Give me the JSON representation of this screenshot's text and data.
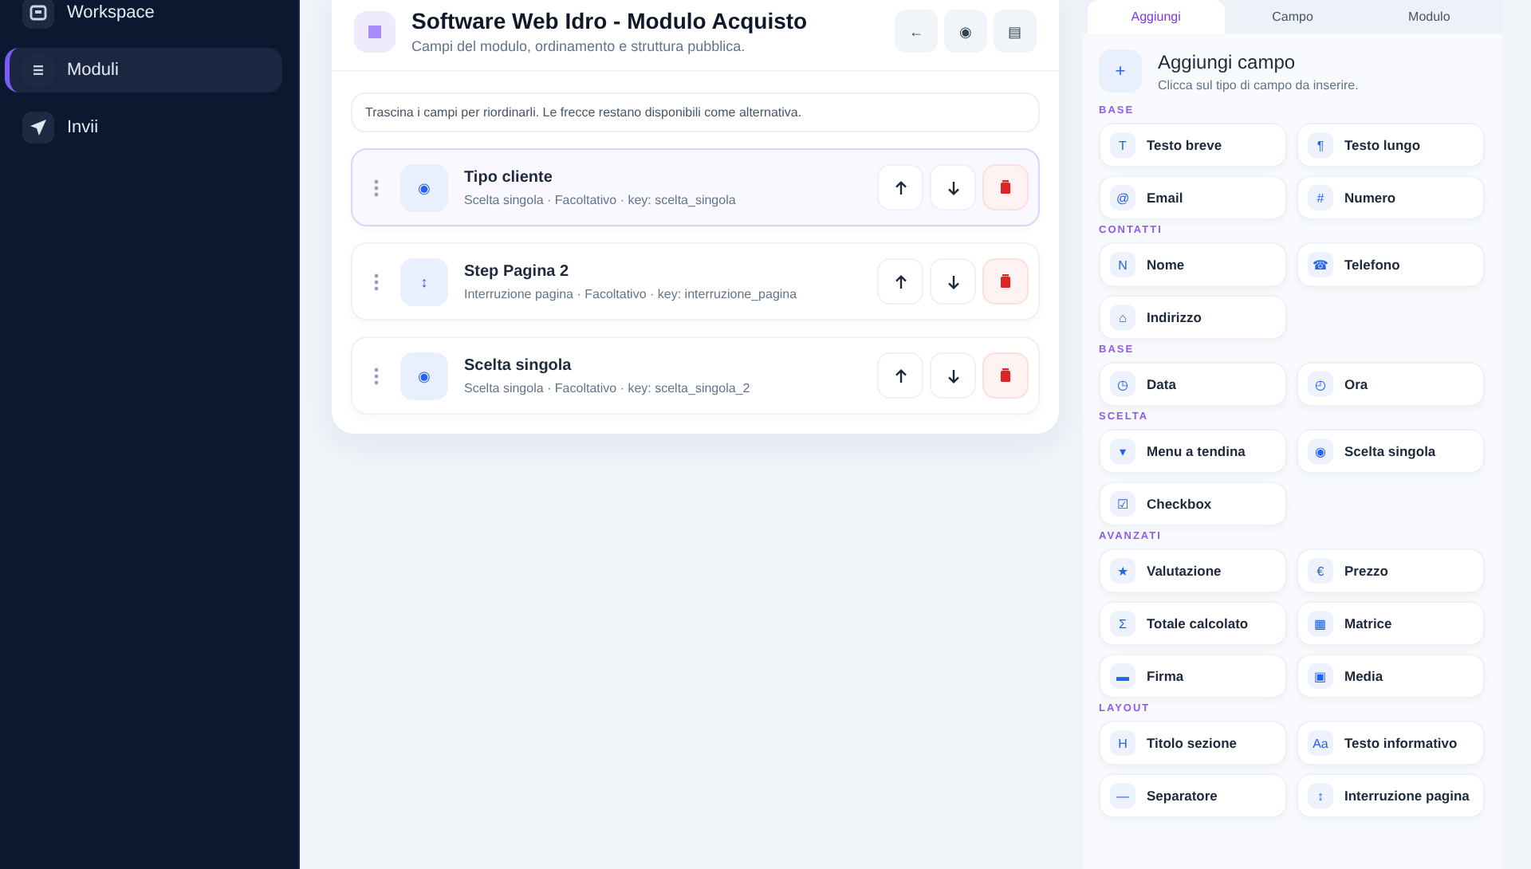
{
  "sidebar": {
    "items": [
      {
        "label": "Workspace",
        "kind": "workspace",
        "selected": false
      },
      {
        "label": "Moduli",
        "kind": "list",
        "selected": true
      },
      {
        "label": "Invii",
        "kind": "send",
        "selected": false
      }
    ]
  },
  "editor": {
    "title": "Software Web Idro - Modulo Acquisto",
    "subtitle": "Campi del modulo, ordinamento e struttura pubblica.",
    "header_buttons": [
      "←",
      "◉",
      "▤"
    ],
    "hint": "Trascina i campi per riordinarli. Le frecce restano disponibili come alternativa.",
    "fields": [
      {
        "name": "Tipo cliente",
        "meta": "Scelta singola · Facoltativo · key: scelta_singola",
        "icon": "◉",
        "selected": true
      },
      {
        "name": "Step Pagina 2",
        "meta": "Interruzione pagina · Facoltativo · key: interruzione_pagina",
        "icon": "↕",
        "selected": false
      },
      {
        "name": "Scelta singola",
        "meta": "Scelta singola · Facoltativo · key: scelta_singola_2",
        "icon": "◉",
        "selected": false
      }
    ]
  },
  "panel": {
    "tabs": [
      {
        "label": "Aggiungi",
        "selected": true
      },
      {
        "label": "Campo",
        "selected": false
      },
      {
        "label": "Modulo",
        "selected": false
      }
    ],
    "icon": "+",
    "title": "Aggiungi campo",
    "subtitle": "Clicca sul tipo di campo da inserire.",
    "groups": [
      {
        "label": "BASE",
        "items": [
          {
            "icon": "T",
            "label": "Testo breve"
          },
          {
            "icon": "¶",
            "label": "Testo lungo"
          },
          {
            "icon": "@",
            "label": "Email"
          },
          {
            "icon": "#",
            "label": "Numero"
          }
        ]
      },
      {
        "label": "CONTATTI",
        "items": [
          {
            "icon": "N",
            "label": "Nome"
          },
          {
            "icon": "☎",
            "label": "Telefono"
          },
          {
            "icon": "⌂",
            "label": "Indirizzo"
          }
        ]
      },
      {
        "label": "BASE",
        "items": [
          {
            "icon": "◷",
            "label": "Data"
          },
          {
            "icon": "◴",
            "label": "Ora"
          }
        ]
      },
      {
        "label": "SCELTA",
        "items": [
          {
            "icon": "▾",
            "label": "Menu a tendina"
          },
          {
            "icon": "◉",
            "label": "Scelta singola"
          },
          {
            "icon": "☑",
            "label": "Checkbox"
          }
        ]
      },
      {
        "label": "AVANZATI",
        "items": [
          {
            "icon": "★",
            "label": "Valutazione"
          },
          {
            "icon": "€",
            "label": "Prezzo"
          },
          {
            "icon": "Σ",
            "label": "Totale calcolato"
          },
          {
            "icon": "▦",
            "label": "Matrice"
          },
          {
            "icon": "▬",
            "label": "Firma"
          },
          {
            "icon": "▣",
            "label": "Media"
          }
        ]
      },
      {
        "label": "LAYOUT",
        "items": [
          {
            "icon": "H",
            "label": "Titolo sezione"
          },
          {
            "icon": "Aa",
            "label": "Testo informativo"
          },
          {
            "icon": "—",
            "label": "Separatore"
          },
          {
            "icon": "↕",
            "label": "Interruzione pagina"
          }
        ]
      }
    ]
  }
}
